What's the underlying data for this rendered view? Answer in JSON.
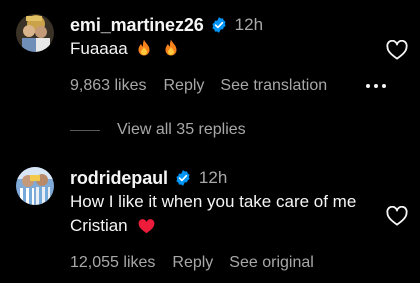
{
  "comments": [
    {
      "username": "emi_martinez26",
      "verified": true,
      "time": "12h",
      "text": "Fuaaaa",
      "emojis": [
        "fire-emoji",
        "fire-emoji"
      ],
      "likes": "9,863 likes",
      "reply_label": "Reply",
      "extra_label": "See translation",
      "liked": false
    },
    {
      "username": "rodridepaul",
      "verified": true,
      "time": "12h",
      "text": "How I like it when you take care of me Cristian",
      "emojis": [
        "red-heart-emoji"
      ],
      "likes": "12,055 likes",
      "reply_label": "Reply",
      "extra_label": "See original",
      "liked": false
    }
  ],
  "view_replies": {
    "label": "View all 35 replies"
  },
  "colors": {
    "background": "#000000",
    "primary_text": "#f5f5f5",
    "secondary_text": "#a8a8a8",
    "verified_badge": "#0095f6",
    "heart_emoji": "#ed1c3b",
    "fire_emoji": "#f7821b"
  }
}
